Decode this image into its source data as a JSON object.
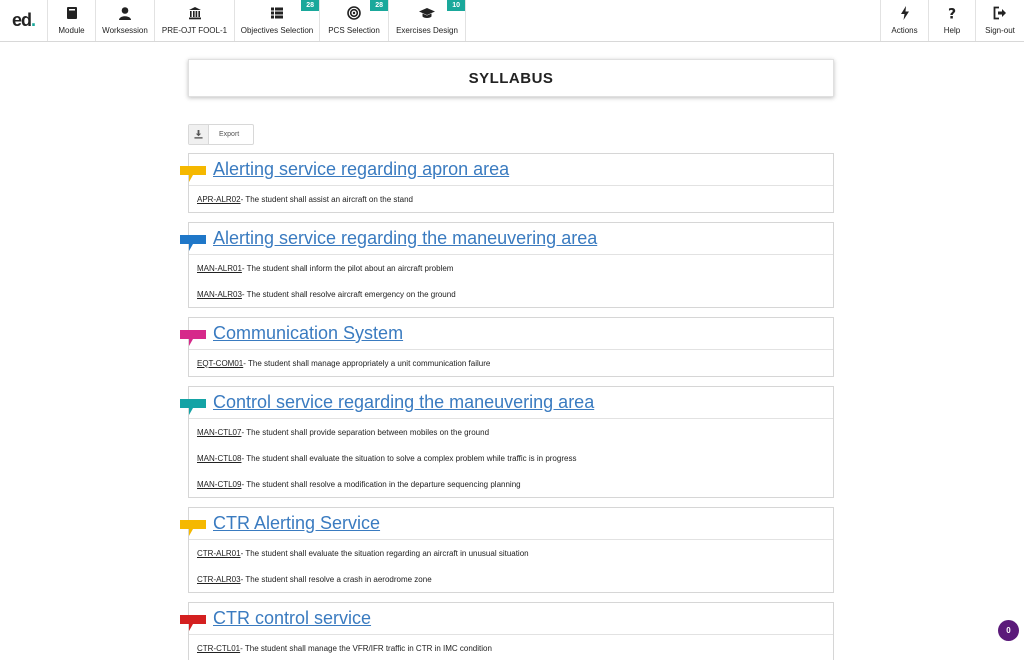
{
  "app": {
    "logo_text": "ed",
    "logo_dot": "."
  },
  "nav": {
    "module": "Module",
    "worksession": "Worksession",
    "pre_ojt": "PRE-OJT FOOL-1",
    "objectives": "Objectives Selection",
    "objectives_badge": "28",
    "pcs": "PCS Selection",
    "pcs_badge": "28",
    "exercises": "Exercises Design",
    "exercises_badge": "10",
    "actions": "Actions",
    "help": "Help",
    "signout": "Sign-out"
  },
  "page_title": "SYLLABUS",
  "export_label": "Export",
  "colors": {
    "accent": "#1aa89b",
    "link": "#3a7bc0",
    "yellow": "#f5b800",
    "blue": "#1f77c8",
    "magenta": "#d6298a",
    "teal": "#14a3a5",
    "red": "#d42020",
    "counter": "#5b1a7a"
  },
  "sections": [
    {
      "title": "Alerting service regarding apron area",
      "flag_color": "#f5b800",
      "items": [
        {
          "code": "APR-ALR02",
          "text": " - The student shall assist an aircraft on the stand"
        }
      ]
    },
    {
      "title": "Alerting service regarding the maneuvering area",
      "flag_color": "#1f77c8",
      "items": [
        {
          "code": "MAN-ALR01",
          "text": " - The student shall inform the pilot about an aircraft problem"
        },
        {
          "code": "MAN-ALR03",
          "text": " - The student shall resolve aircraft emergency on the ground"
        }
      ]
    },
    {
      "title": "Communication System",
      "flag_color": "#d6298a",
      "items": [
        {
          "code": "EQT-COM01",
          "text": " - The student shall manage appropriately a unit communication failure"
        }
      ]
    },
    {
      "title": "Control service regarding the maneuvering area",
      "flag_color": "#14a3a5",
      "items": [
        {
          "code": "MAN-CTL07",
          "text": " - The student shall provide separation between mobiles on the ground"
        },
        {
          "code": "MAN-CTL08",
          "text": " - The student shall evaluate the situation to solve a complex problem while traffic is in progress"
        },
        {
          "code": "MAN-CTL09",
          "text": " - The student shall resolve a modification in the departure sequencing planning"
        }
      ]
    },
    {
      "title": "CTR Alerting Service",
      "flag_color": "#f5b800",
      "items": [
        {
          "code": "CTR-ALR01",
          "text": " - The student shall evaluate the situation regarding an aircraft in unusual situation"
        },
        {
          "code": "CTR-ALR03",
          "text": " - The student shall resolve a crash in aerodrome zone"
        }
      ]
    },
    {
      "title": "CTR control service",
      "flag_color": "#d42020",
      "items": [
        {
          "code": "CTR-CTL01",
          "text": " - The student shall manage the VFR/IFR traffic in CTR in IMC condition"
        }
      ]
    }
  ],
  "counter": "0"
}
